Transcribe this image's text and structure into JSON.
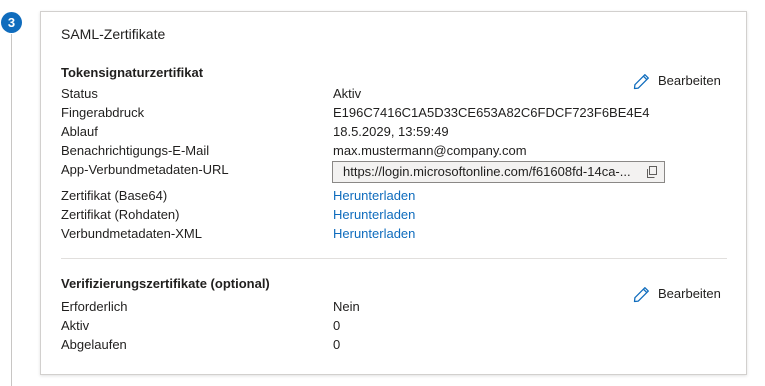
{
  "step": {
    "number": "3"
  },
  "card": {
    "title": "SAML-Zertifikate"
  },
  "token_section": {
    "title": "Tokensignaturzertifikat",
    "edit_label": "Bearbeiten",
    "rows": [
      {
        "label": "Status",
        "value": "Aktiv"
      },
      {
        "label": "Fingerabdruck",
        "value": "E196C7416C1A5D33CE653A82C6FDCF723F6BE4E4"
      },
      {
        "label": "Ablauf",
        "value": "18.5.2029, 13:59:49"
      },
      {
        "label": "Benachrichtigungs-E-Mail",
        "value": "max.mustermann@company.com"
      },
      {
        "label": "App-Verbundmetadaten-URL",
        "value": "https://login.microsoftonline.com/f61608fd-14ca-..."
      },
      {
        "label": "Zertifikat (Base64)",
        "value": "Herunterladen"
      },
      {
        "label": "Zertifikat (Rohdaten)",
        "value": "Herunterladen"
      },
      {
        "label": "Verbundmetadaten-XML",
        "value": "Herunterladen"
      }
    ]
  },
  "verify_section": {
    "title": "Verifizierungszertifikate (optional)",
    "edit_label": "Bearbeiten",
    "rows": [
      {
        "label": "Erforderlich",
        "value": "Nein"
      },
      {
        "label": "Aktiv",
        "value": "0"
      },
      {
        "label": "Abgelaufen",
        "value": "0"
      }
    ]
  },
  "icons": {
    "edit": "pencil-icon",
    "copy": "copy-icon"
  },
  "colors": {
    "accent": "#0f6cbd",
    "border": "#d2d0ce"
  }
}
